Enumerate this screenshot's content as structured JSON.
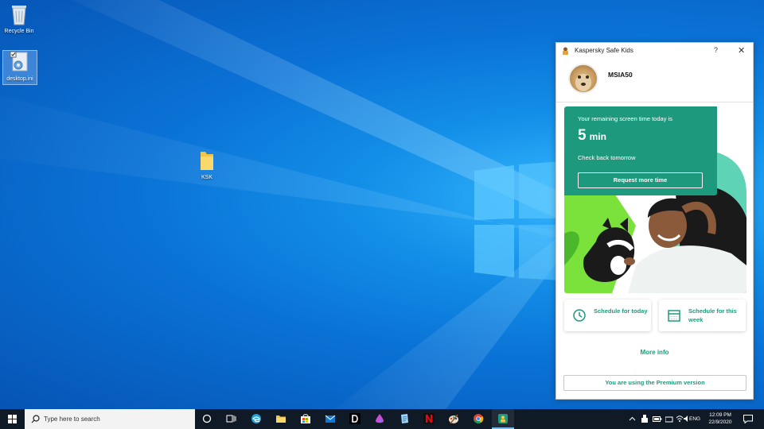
{
  "desktop": {
    "icons": [
      {
        "label": "Recycle Bin"
      },
      {
        "label": "desktop.ini"
      },
      {
        "label": "KSK"
      }
    ]
  },
  "kaspersky": {
    "title": "Kaspersky Safe Kids",
    "help_label": "?",
    "close_label": "✕",
    "username": "MSIA50",
    "card": {
      "remaining_label": "Your remaining screen time today is",
      "minutes_value": "5",
      "minutes_unit": "min",
      "check_back": "Check back tomorrow",
      "request_button": "Request more time"
    },
    "schedule_today": "Schedule for today",
    "schedule_week": "Schedule for this week",
    "more_info": "More info",
    "premium_notice": "You are using the Premium version",
    "accent_color": "#1d9a7e"
  },
  "taskbar": {
    "search_placeholder": "Type here to search",
    "apps": [
      "task-view-icon",
      "file-explorer-icon",
      "edge-icon",
      "folder-icon",
      "store-icon",
      "mail-icon",
      "d-app-icon",
      "paint-drop-icon",
      "notepad-icon",
      "netflix-icon",
      "paint-icon",
      "chrome-icon",
      "kaspersky-icon"
    ],
    "language": "ENG",
    "time": "12:09 PM",
    "date": "22/9/2020"
  }
}
